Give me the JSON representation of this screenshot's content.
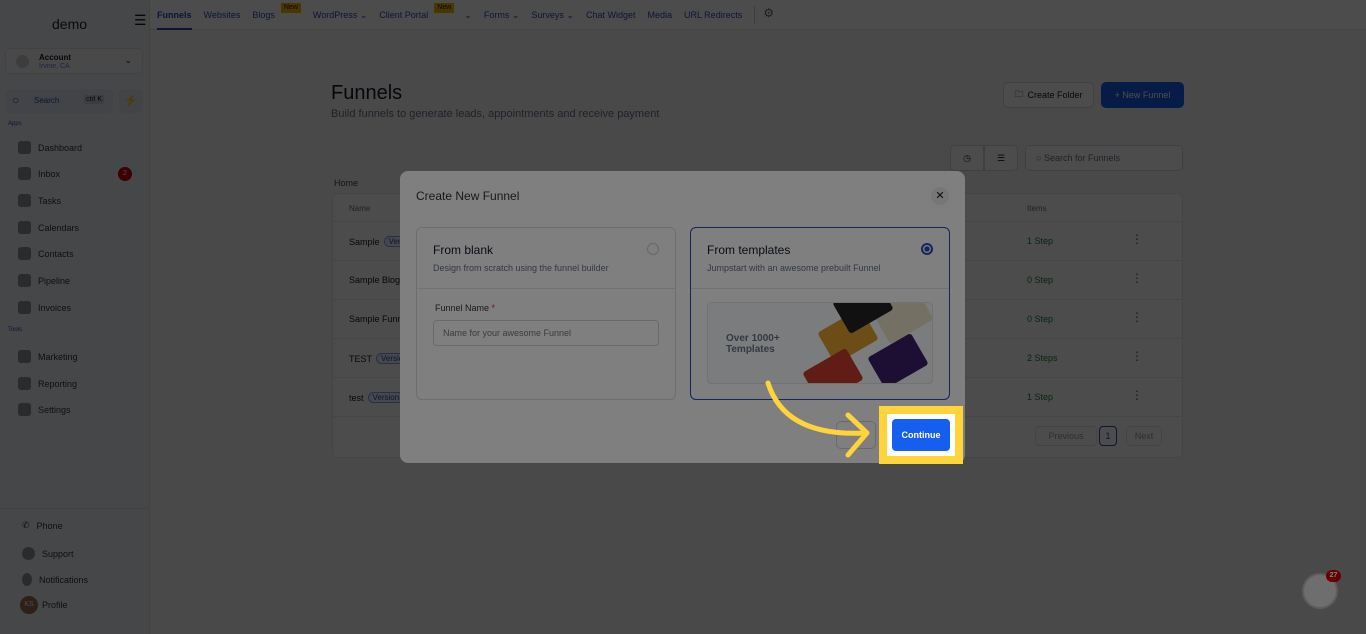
{
  "sidebar": {
    "logo": "demo",
    "account": {
      "name": "Account",
      "location": "Irvine, CA"
    },
    "search": {
      "label": "Search",
      "shortcut": "ctrl K"
    },
    "apps_label": "Apps",
    "tools_label": "Tools",
    "apps": [
      {
        "label": "Dashboard"
      },
      {
        "label": "Inbox",
        "badge": "2"
      },
      {
        "label": "Tasks"
      },
      {
        "label": "Calendars"
      },
      {
        "label": "Contacts"
      },
      {
        "label": "Pipeline"
      },
      {
        "label": "Invoices"
      }
    ],
    "tools": [
      {
        "label": "Marketing"
      },
      {
        "label": "Reporting"
      },
      {
        "label": "Settings"
      }
    ],
    "bottom": [
      {
        "label": "Phone"
      },
      {
        "label": "Support"
      },
      {
        "label": "Notifications"
      },
      {
        "label": "Profile",
        "initials": "KS"
      }
    ]
  },
  "topnav": {
    "tabs": [
      {
        "label": "Funnels"
      },
      {
        "label": "Websites"
      },
      {
        "label": "Blogs",
        "badge": "New"
      },
      {
        "label": "WordPress ⌄"
      },
      {
        "label": "Client Portal",
        "badge": "New"
      },
      {
        "label": "⌄"
      },
      {
        "label": "Forms ⌄"
      },
      {
        "label": "Surveys ⌄"
      },
      {
        "label": "Chat Widget"
      },
      {
        "label": "Media"
      },
      {
        "label": "URL Redirects"
      }
    ]
  },
  "page": {
    "title": "Funnels",
    "subtitle": "Build funnels to generate leads, appointments and receive payment",
    "create_folder": "Create Folder",
    "new_funnel": "+ New Funnel",
    "search_placeholder": "Search for Funnels",
    "breadcrumb": "Home"
  },
  "table": {
    "headers": {
      "name": "Name",
      "items": "Items"
    },
    "rows": [
      {
        "name": "Sample",
        "badge": "Version",
        "items": "1 Step"
      },
      {
        "name": "Sample Blog",
        "badge": "",
        "items": "0 Step"
      },
      {
        "name": "Sample Funn",
        "badge": "",
        "items": "0 Step"
      },
      {
        "name": "TEST",
        "badge": "Version",
        "items": "2 Steps"
      },
      {
        "name": "test",
        "badge": "Version",
        "items": "1 Step"
      }
    ],
    "pagination": {
      "previous": "Previous",
      "page": "1",
      "next": "Next"
    }
  },
  "modal": {
    "title": "Create New Funnel",
    "blank": {
      "title": "From blank",
      "desc": "Design from scratch using the funnel builder",
      "field_label": "Funnel Name",
      "required": "*",
      "placeholder": "Name for your awesome Funnel"
    },
    "templates": {
      "title": "From templates",
      "desc": "Jumpstart with an awesome prebuilt Funnel",
      "promo": "Over 1000+ Templates"
    },
    "selected": "templates",
    "continue": "Continue"
  },
  "chat_widget": {
    "badge": "27"
  },
  "colors": {
    "primary": "#155eef",
    "highlight": "#ffd43b",
    "badge": "#cc0000"
  }
}
